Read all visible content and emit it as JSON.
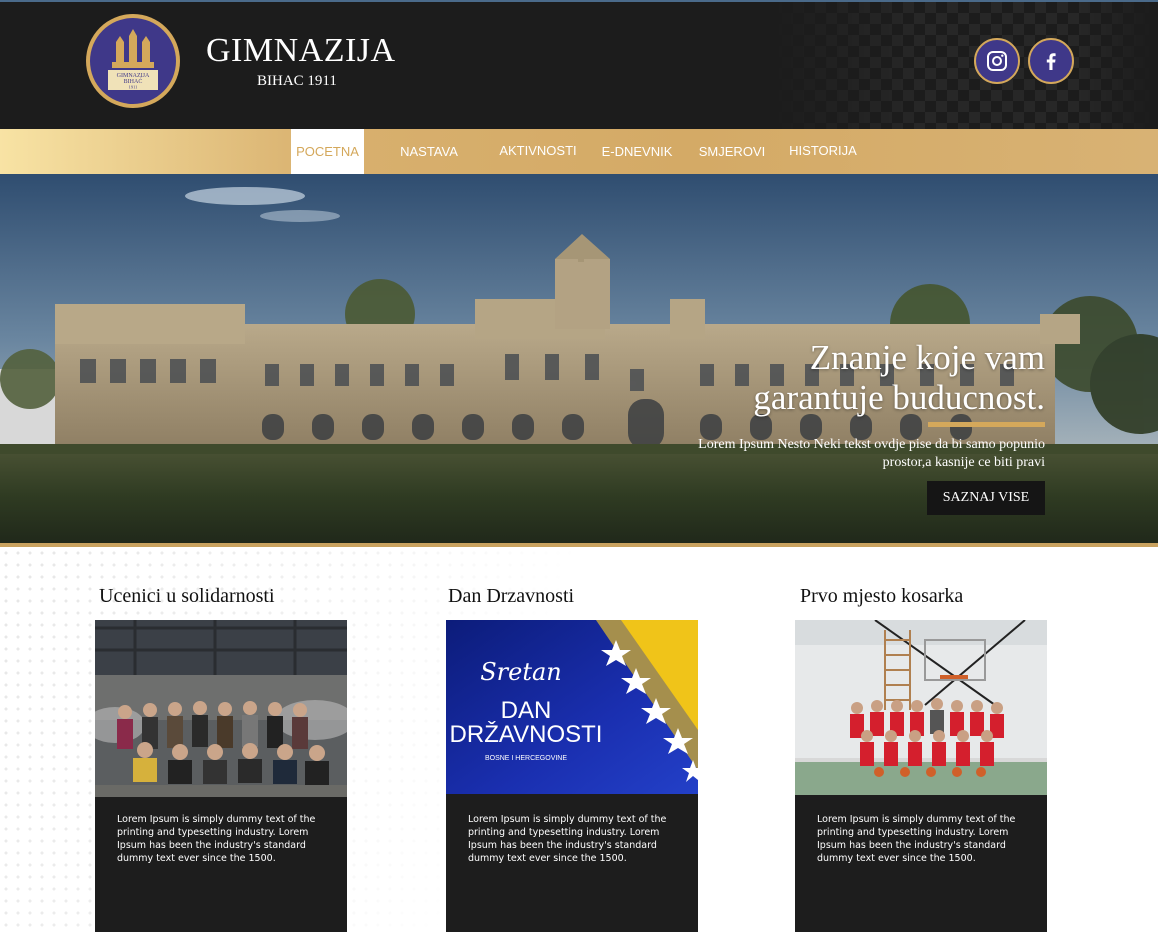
{
  "brand": {
    "title": "GIMNAZIJA",
    "subtitle": "BIHAC 1911",
    "logo_text_1": "GIMNAZIJA",
    "logo_text_2": "BIHAĆ",
    "logo_text_3": "1911"
  },
  "social": [
    {
      "name": "instagram",
      "icon": "instagram-icon"
    },
    {
      "name": "facebook",
      "icon": "facebook-icon"
    }
  ],
  "nav": {
    "items": [
      {
        "label": "POCETNA",
        "active": true
      },
      {
        "label": "NASTAVA",
        "active": false
      },
      {
        "label": "AKTIVNOSTI",
        "active": false
      },
      {
        "label": "E-DNEVNIK",
        "active": false
      },
      {
        "label": "SMJEROVI",
        "active": false
      },
      {
        "label": "HISTORIJA",
        "active": false
      }
    ]
  },
  "hero": {
    "title_line_1": "Znanje koje vam",
    "title_line_2": "garantuje buducnost.",
    "text_line_1": "Lorem Ipsum Nesto Neki tekst ovdje pise da bi samo popunio",
    "text_line_2": "prostor,a kasnije ce biti pravi",
    "button_label": "SAZNAJ VISE"
  },
  "cards": [
    {
      "title": "Ucenici u solidarnosti",
      "text": "Lorem Ipsum is simply dummy text of the printing and typesetting industry. Lorem Ipsum has been the industry's standard dummy text ever since the 1500."
    },
    {
      "title": "Dan Drzavnosti",
      "text": "Lorem Ipsum is simply dummy text of the printing and typesetting industry. Lorem Ipsum has been the industry's standard dummy text ever since the 1500.",
      "image_script": "Sretan",
      "image_title_1": "DAN",
      "image_title_2": "DRŽAVNOSTI",
      "image_caption": "BOSNE I HERCEGOVINE"
    },
    {
      "title": "Prvo mjesto kosarka",
      "text": "Lorem Ipsum is simply dummy text of the printing and typesetting industry. Lorem Ipsum has been the industry's standard dummy text ever since the 1500."
    }
  ],
  "colors": {
    "gold": "#d4a85b",
    "header_bg": "#1c1c1c",
    "logo_blue": "#3f3889",
    "card_bg": "#1d1d1d"
  }
}
